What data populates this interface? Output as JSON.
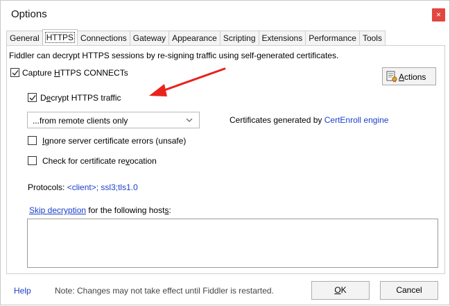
{
  "window": {
    "title": "Options",
    "close_glyph": "×"
  },
  "tabs": [
    {
      "label": "General",
      "active": false
    },
    {
      "label": "HTTPS",
      "active": true
    },
    {
      "label": "Connections",
      "active": false
    },
    {
      "label": "Gateway",
      "active": false
    },
    {
      "label": "Appearance",
      "active": false
    },
    {
      "label": "Scripting",
      "active": false
    },
    {
      "label": "Extensions",
      "active": false
    },
    {
      "label": "Performance",
      "active": false
    },
    {
      "label": "Tools",
      "active": false
    }
  ],
  "https": {
    "intro_text": "Fiddler can decrypt HTTPS sessions by re-signing traffic using self-generated certificates.",
    "capture_label_pre": "Capture ",
    "capture_label_key": "H",
    "capture_label_post": "TTPS CONNECTs",
    "capture_checked": true,
    "decrypt_label_pre": "D",
    "decrypt_label_key": "e",
    "decrypt_label_post": "crypt HTTPS traffic",
    "decrypt_checked": true,
    "source_select_value": "...from remote clients only",
    "cert_text": "Certificates generated by ",
    "cert_link": "CertEnroll engine",
    "ignore_errors_key": "I",
    "ignore_errors_post": "gnore server certificate errors (unsafe)",
    "ignore_errors_checked": false,
    "revocation_pre": "Check for certificate re",
    "revocation_key": "v",
    "revocation_post": "ocation",
    "revocation_checked": false,
    "protocols_label": "Protocols: ",
    "protocols_value": "<client>; ssl3;tls1.0",
    "skip_link": "Skip decryption",
    "skip_text_pre": " for the following host",
    "skip_text_key": "s",
    "skip_text_post": ":",
    "hosts_value": "",
    "actions_label_key": "A",
    "actions_label_post": "ctions"
  },
  "footer": {
    "help_link": "Help",
    "note": "Note: Changes may not take effect until Fiddler is restarted.",
    "ok_key": "O",
    "ok_post": "K",
    "cancel_label": "Cancel"
  },
  "colors": {
    "link": "#1a3ec9",
    "close_button": "#e3463f",
    "annotation_arrow": "#e8231c"
  },
  "icons": {
    "actions": "certificate-actions-icon",
    "select": "chevron-down-icon",
    "check": "checkmark-icon"
  }
}
